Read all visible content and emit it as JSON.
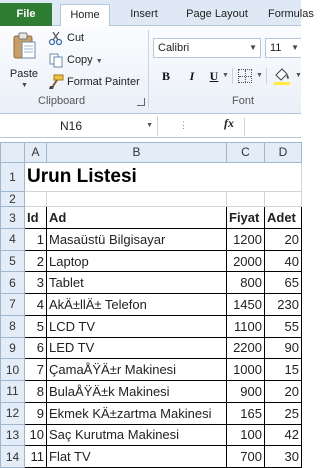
{
  "ribbon": {
    "tabs": [
      "File",
      "Home",
      "Insert",
      "Page Layout",
      "Formulas"
    ],
    "clipboard": {
      "paste_label": "Paste",
      "cut_label": "Cut",
      "copy_label": "Copy",
      "format_painter_label": "Format Painter",
      "group_label": "Clipboard"
    },
    "font": {
      "family": "Calibri",
      "size": "11",
      "bold": "B",
      "italic": "I",
      "underline": "U",
      "group_label": "Font"
    }
  },
  "formula_bar": {
    "name_box": "N16",
    "fx_label": "fx",
    "value": ""
  },
  "sheet": {
    "columns": [
      "A",
      "B",
      "C",
      "D"
    ],
    "title_row": "1",
    "title": "Urun Listesi",
    "blank_row": "2",
    "header_row": "3",
    "headers": [
      "Id",
      "Ad",
      "Fiyat",
      "Adet"
    ],
    "rows": [
      {
        "row": "4",
        "id": "1",
        "ad": "Masaüstü Bilgisayar",
        "fiyat": "1200",
        "adet": "20"
      },
      {
        "row": "5",
        "id": "2",
        "ad": "Laptop",
        "fiyat": "2000",
        "adet": "40"
      },
      {
        "row": "6",
        "id": "3",
        "ad": "Tablet",
        "fiyat": "800",
        "adet": "65"
      },
      {
        "row": "7",
        "id": "4",
        "ad": "AkÄ±llÄ± Telefon",
        "fiyat": "1450",
        "adet": "230"
      },
      {
        "row": "8",
        "id": "5",
        "ad": "LCD TV",
        "fiyat": "1100",
        "adet": "55"
      },
      {
        "row": "9",
        "id": "6",
        "ad": "LED TV",
        "fiyat": "2200",
        "adet": "90"
      },
      {
        "row": "10",
        "id": "7",
        "ad": "ÇamaÅŸÄ±r Makinesi",
        "fiyat": "1000",
        "adet": "15"
      },
      {
        "row": "11",
        "id": "8",
        "ad": "BulaÅŸÄ±k Makinesi",
        "fiyat": "900",
        "adet": "20"
      },
      {
        "row": "12",
        "id": "9",
        "ad": "Ekmek KÄ±zartma Makinesi",
        "fiyat": "165",
        "adet": "25"
      },
      {
        "row": "13",
        "id": "10",
        "ad": "Saç Kurutma Makinesi",
        "fiyat": "100",
        "adet": "42"
      },
      {
        "row": "14",
        "id": "11",
        "ad": "Flat TV",
        "fiyat": "700",
        "adet": "30"
      }
    ]
  },
  "colors": {
    "file_tab": "#2f7d32",
    "header_bg": "#e4ecf7",
    "ribbon_bg": "#eaf0f8"
  }
}
